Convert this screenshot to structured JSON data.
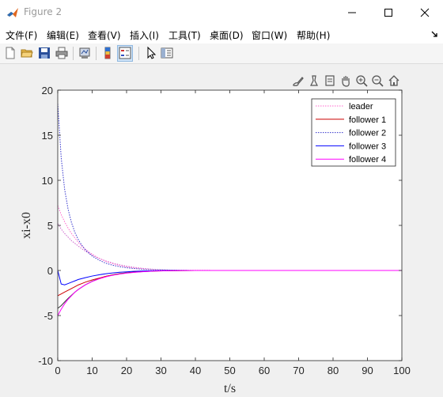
{
  "window": {
    "title": "Figure 2",
    "icon": "matlab-icon",
    "controls": [
      "minimize-icon",
      "maximize-icon",
      "close-icon"
    ]
  },
  "menu": {
    "items": [
      "文件(F)",
      "编辑(E)",
      "查看(V)",
      "插入(I)",
      "工具(T)",
      "桌面(D)",
      "窗口(W)",
      "帮助(H)"
    ]
  },
  "toolbar": {
    "icons": [
      "new-figure-icon",
      "open-file-icon",
      "save-icon",
      "print-icon",
      "link-plot-icon",
      "colorbar-icon",
      "legend-icon",
      "edit-plot-arrow-icon",
      "property-inspector-icon"
    ]
  },
  "axes_toolbar": {
    "icons": [
      "brush-icon",
      "data-tips-icon",
      "export-icon",
      "pan-icon",
      "zoom-in-icon",
      "zoom-out-icon",
      "home-icon"
    ]
  },
  "colors": {
    "leader": "#ff66cc",
    "follower_1": "#cc0000",
    "follower_2": "#3333cc",
    "follower_3": "#0000ff",
    "follower_4": "#ff00ff"
  },
  "chart_data": {
    "type": "line",
    "xlabel": "t/s",
    "ylabel": "xi-x0",
    "xlim": [
      0,
      100
    ],
    "ylim": [
      -10,
      20
    ],
    "xticks": [
      0,
      10,
      20,
      30,
      40,
      50,
      60,
      70,
      80,
      90,
      100
    ],
    "yticks": [
      -10,
      -5,
      0,
      5,
      10,
      15,
      20
    ],
    "grid": false,
    "legend_position": "top-right",
    "x": [
      0,
      1,
      2,
      3,
      4,
      5,
      6,
      7,
      8,
      10,
      12,
      14,
      16,
      18,
      20,
      22,
      25,
      28,
      32,
      36,
      40,
      50,
      60,
      70,
      80,
      90,
      100
    ],
    "series": [
      {
        "name": "leader",
        "style": "dotted",
        "color": "#ff66cc",
        "values": [
          7.2,
          6.2,
          5.4,
          4.7,
          4.1,
          3.6,
          3.1,
          2.7,
          2.35,
          1.8,
          1.35,
          1.0,
          0.75,
          0.55,
          0.4,
          0.3,
          0.18,
          0.1,
          0.05,
          0.02,
          0.01,
          0,
          0,
          0,
          0,
          0,
          0
        ]
      },
      {
        "name": "follower 1",
        "style": "solid",
        "color": "#cc0000",
        "values": [
          -2.8,
          -2.6,
          -2.4,
          -2.2,
          -2.0,
          -1.8,
          -1.6,
          -1.45,
          -1.3,
          -1.05,
          -0.85,
          -0.65,
          -0.5,
          -0.38,
          -0.28,
          -0.2,
          -0.12,
          -0.07,
          -0.03,
          -0.01,
          0,
          0,
          0,
          0,
          0,
          0,
          0
        ]
      },
      {
        "name": "follower 2",
        "style": "dotted",
        "color": "#3333cc",
        "values": [
          18.5,
          12.5,
          9.0,
          6.8,
          5.3,
          4.2,
          3.4,
          2.8,
          2.3,
          1.6,
          1.15,
          0.8,
          0.58,
          0.42,
          0.3,
          0.22,
          0.13,
          0.07,
          0.03,
          0.01,
          0,
          0,
          0,
          0,
          0,
          0,
          0
        ]
      },
      {
        "name": "follower 3",
        "style": "solid",
        "color": "#0000ff",
        "values": [
          0,
          -1.5,
          -1.6,
          -1.45,
          -1.3,
          -1.15,
          -1.0,
          -0.9,
          -0.8,
          -0.62,
          -0.48,
          -0.36,
          -0.27,
          -0.2,
          -0.15,
          -0.1,
          -0.06,
          -0.03,
          -0.01,
          0,
          0,
          0,
          0,
          0,
          0,
          0,
          0
        ]
      },
      {
        "name": "follower 4",
        "style": "solid",
        "color": "#ff00ff",
        "values": [
          -5.0,
          -4.3,
          -3.7,
          -3.2,
          -2.8,
          -2.4,
          -2.1,
          -1.85,
          -1.6,
          -1.22,
          -0.93,
          -0.7,
          -0.53,
          -0.4,
          -0.3,
          -0.22,
          -0.13,
          -0.07,
          -0.03,
          -0.01,
          0,
          0,
          0,
          0,
          0,
          0,
          0
        ]
      }
    ],
    "extra_curves": [
      {
        "style": "dotted",
        "color": "#cc66cc",
        "values": [
          5.2,
          4.6,
          4.1,
          3.7,
          3.3,
          3.0,
          2.7,
          2.4,
          2.15,
          1.7,
          1.35,
          1.05,
          0.82,
          0.63,
          0.48,
          0.36,
          0.22,
          0.12,
          0.05,
          0.02,
          0.01,
          0,
          0,
          0,
          0,
          0,
          0
        ]
      },
      {
        "style": "solid",
        "color": "#333333",
        "values": [
          -4.2,
          -3.9,
          -3.5,
          -3.1,
          -2.75,
          -2.4,
          -2.1,
          -1.85,
          -1.6,
          -1.2,
          -0.9,
          -0.66,
          -0.48,
          -0.35,
          -0.25,
          -0.18,
          -0.1,
          -0.05,
          -0.02,
          -0.01,
          0,
          0,
          0,
          0,
          0,
          0,
          0
        ]
      }
    ]
  }
}
